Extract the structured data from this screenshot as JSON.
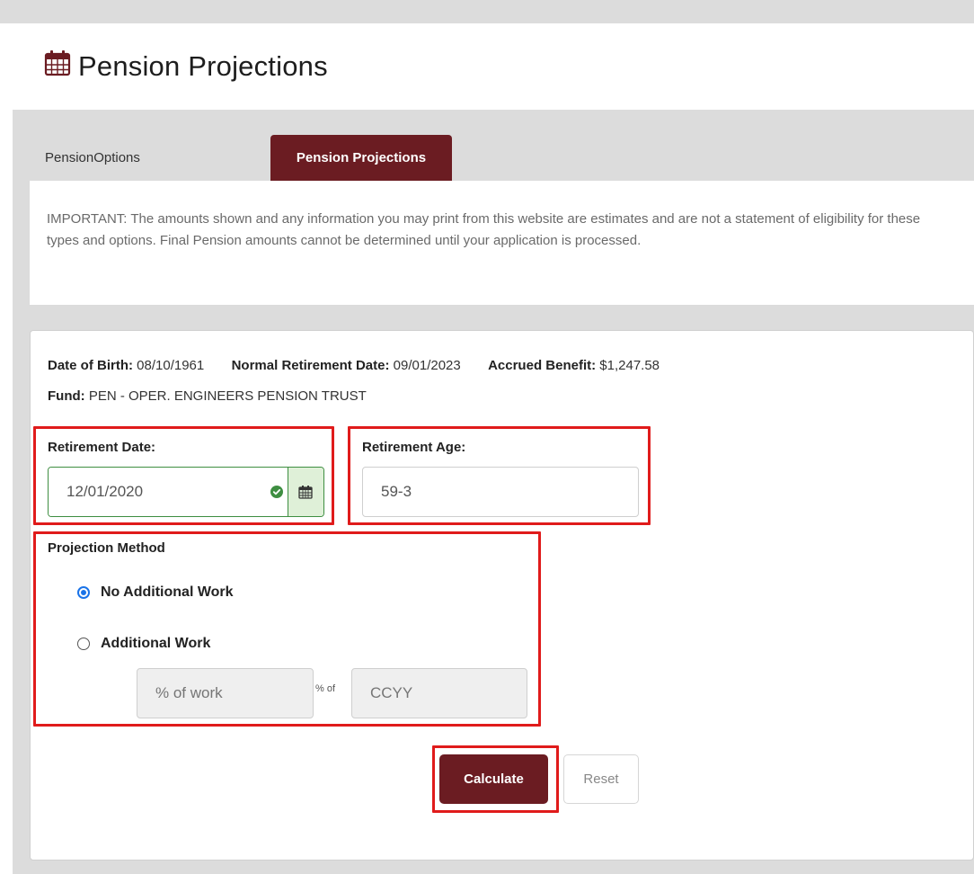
{
  "header": {
    "title": "Pension Projections",
    "icon": "calendar-icon"
  },
  "tabs": [
    {
      "label": "PensionOptions",
      "active": false
    },
    {
      "label": "Pension Projections",
      "active": true
    }
  ],
  "notice": "IMPORTANT: The amounts shown and any information you may print from this website are estimates and are not a statement of eligibility for these types and options. Final Pension amounts cannot be determined until your application is processed.",
  "member": {
    "dob_label": "Date of Birth:",
    "dob": "08/10/1961",
    "nrd_label": "Normal Retirement Date:",
    "nrd": "09/01/2023",
    "benefit_label": "Accrued Benefit:",
    "benefit": "$1,247.58",
    "fund_label": "Fund:",
    "fund": "PEN - OPER. ENGINEERS PENSION TRUST"
  },
  "retirement_date": {
    "label": "Retirement Date:",
    "value": "12/01/2020"
  },
  "retirement_age": {
    "label": "Retirement Age:",
    "value": "59-3"
  },
  "projection": {
    "label": "Projection Method",
    "options": [
      {
        "label": "No Additional Work",
        "checked": true
      },
      {
        "label": "Additional Work",
        "checked": false
      }
    ],
    "work_percent_placeholder": "% of work",
    "of_label": "% of",
    "year_placeholder": "CCYY"
  },
  "buttons": {
    "calculate": "Calculate",
    "reset": "Reset"
  },
  "colors": {
    "brand": "#6b1c22",
    "highlight": "#e01b1b",
    "valid": "#3e8e41",
    "radio": "#1a73e8"
  }
}
